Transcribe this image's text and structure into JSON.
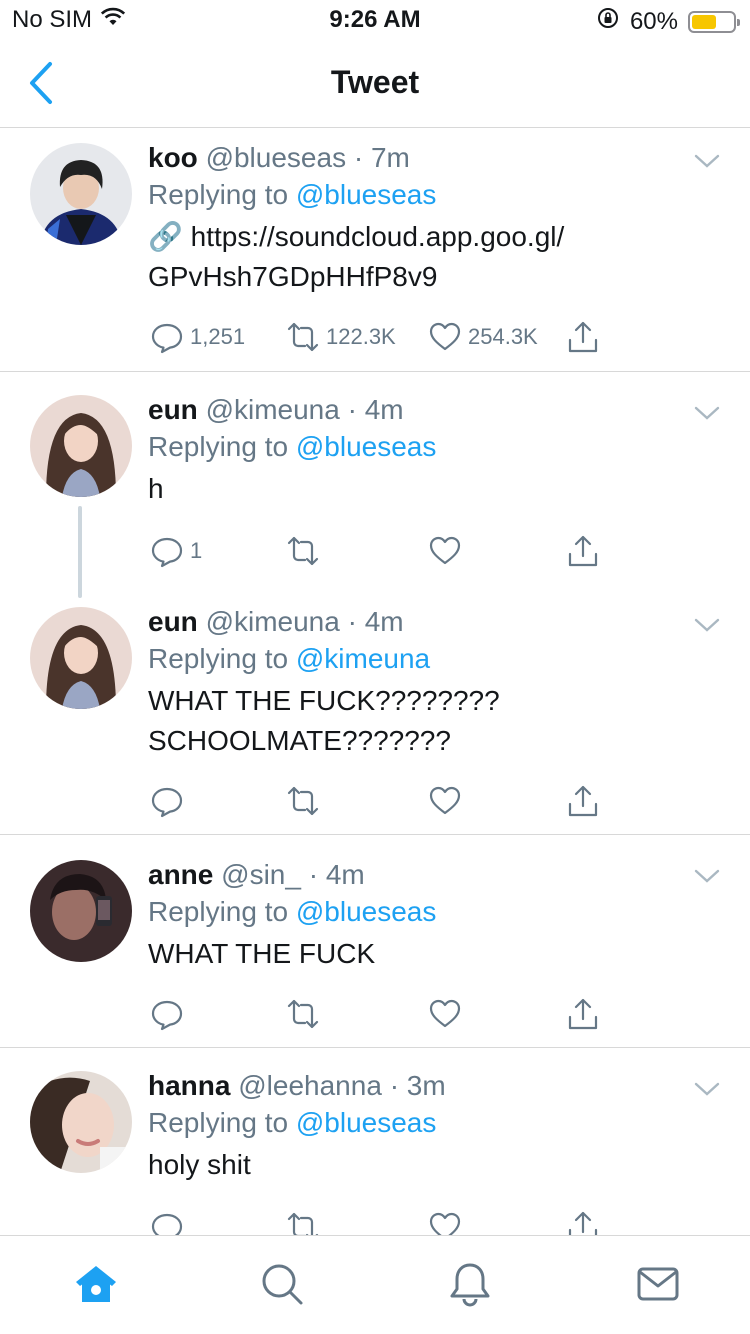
{
  "status_bar": {
    "carrier": "No SIM",
    "time": "9:26 AM",
    "battery": "60%",
    "battery_level": 0.6
  },
  "nav": {
    "title": "Tweet"
  },
  "tweets": [
    {
      "name": "koo",
      "handle": "@blueseas",
      "dot": "·",
      "time": "7m",
      "replying_prefix": "Replying to",
      "replying_to": "@blueseas",
      "link_icon": "🔗",
      "text_line1": "https://soundcloud.app.goo.gl/",
      "text_line2": "GPvHsh7GDpHHfP8v9",
      "replies": "1,251",
      "retweets": "122.3K",
      "likes": "254.3K"
    },
    {
      "name": "eun",
      "handle": "@kimeuna",
      "dot": "·",
      "time": "4m",
      "replying_prefix": "Replying to",
      "replying_to": "@blueseas",
      "text_line1": "h",
      "replies": "1"
    },
    {
      "name": "eun",
      "handle": "@kimeuna",
      "dot": "·",
      "time": "4m",
      "replying_prefix": "Replying to",
      "replying_to": "@kimeuna",
      "text_line1": "WHAT THE FUCK????????",
      "text_line2": "SCHOOLMATE???????"
    },
    {
      "name": "anne",
      "handle": "@sin_",
      "dot": "·",
      "time": "4m",
      "replying_prefix": "Replying to",
      "replying_to": "@blueseas",
      "text_line1": "WHAT THE FUCK"
    },
    {
      "name": "hanna",
      "handle": "@leehanna",
      "dot": "·",
      "time": "3m",
      "replying_prefix": "Replying to",
      "replying_to": "@blueseas",
      "text_line1": "holy shit"
    }
  ],
  "icons": {
    "wifi": "wifi-icon",
    "lock_rotation": "orientation-lock-icon",
    "battery": "battery-icon",
    "back": "chevron-left-icon",
    "more": "chevron-down-icon",
    "reply": "reply-icon",
    "retweet": "retweet-icon",
    "like": "heart-icon",
    "share": "share-icon",
    "home": "home-icon",
    "search": "search-icon",
    "notifications": "bell-icon",
    "messages": "mail-icon"
  },
  "colors": {
    "accent": "#1da1f2",
    "text": "#14171a",
    "secondary": "#657786",
    "battery_fill": "#f7c600"
  }
}
